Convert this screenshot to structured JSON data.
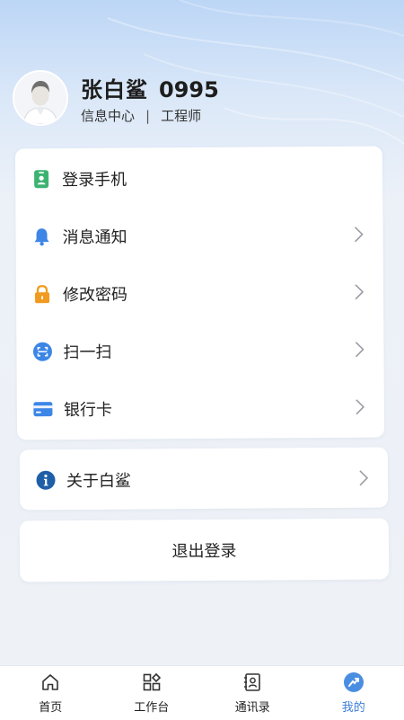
{
  "profile": {
    "name": "张白鲨",
    "employee_no": "0995",
    "department": "信息中心",
    "separator": "|",
    "title": "工程师"
  },
  "menu": {
    "items": [
      {
        "label": "登录手机",
        "icon": "phone-badge-icon",
        "icon_color": "#3cb371",
        "has_chevron": false
      },
      {
        "label": "消息通知",
        "icon": "bell-icon",
        "icon_color": "#3d86e6",
        "has_chevron": true
      },
      {
        "label": "修改密码",
        "icon": "lock-icon",
        "icon_color": "#f29a1f",
        "has_chevron": true
      },
      {
        "label": "扫一扫",
        "icon": "scan-icon",
        "icon_color": "#3d86e6",
        "has_chevron": true
      },
      {
        "label": "银行卡",
        "icon": "bank-card-icon",
        "icon_color": "#3d86e6",
        "has_chevron": true
      }
    ],
    "about": {
      "label": "关于白鲨",
      "icon": "info-icon",
      "icon_color": "#1f5fa8"
    },
    "logout_label": "退出登录"
  },
  "tabbar": {
    "tabs": [
      {
        "label": "首页",
        "icon": "home-icon"
      },
      {
        "label": "工作台",
        "icon": "grid-icon"
      },
      {
        "label": "通讯录",
        "icon": "contacts-icon"
      },
      {
        "label": "我的",
        "icon": "profile-icon",
        "active": true
      }
    ],
    "active_color": "#3d7fd6"
  }
}
